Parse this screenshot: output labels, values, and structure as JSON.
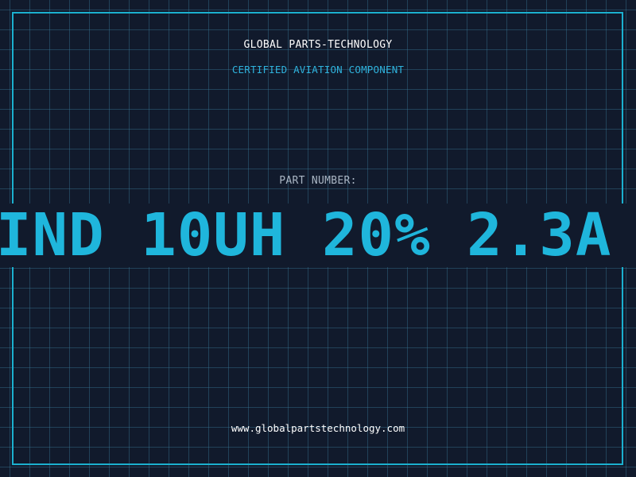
{
  "header": {
    "brand": "GLOBAL PARTS-TECHNOLOGY",
    "subtitle": "CERTIFIED AVIATION COMPONENT"
  },
  "part": {
    "label": "PART NUMBER:",
    "number": "IND 10UH 20% 2.3A"
  },
  "footer": {
    "url": "www.globalpartstechnology.com"
  },
  "colors": {
    "background": "#111a2c",
    "grid": "#3a7896",
    "accent": "#1bb0cf",
    "text_primary": "#ffffff",
    "text_muted": "#aab6c4"
  }
}
